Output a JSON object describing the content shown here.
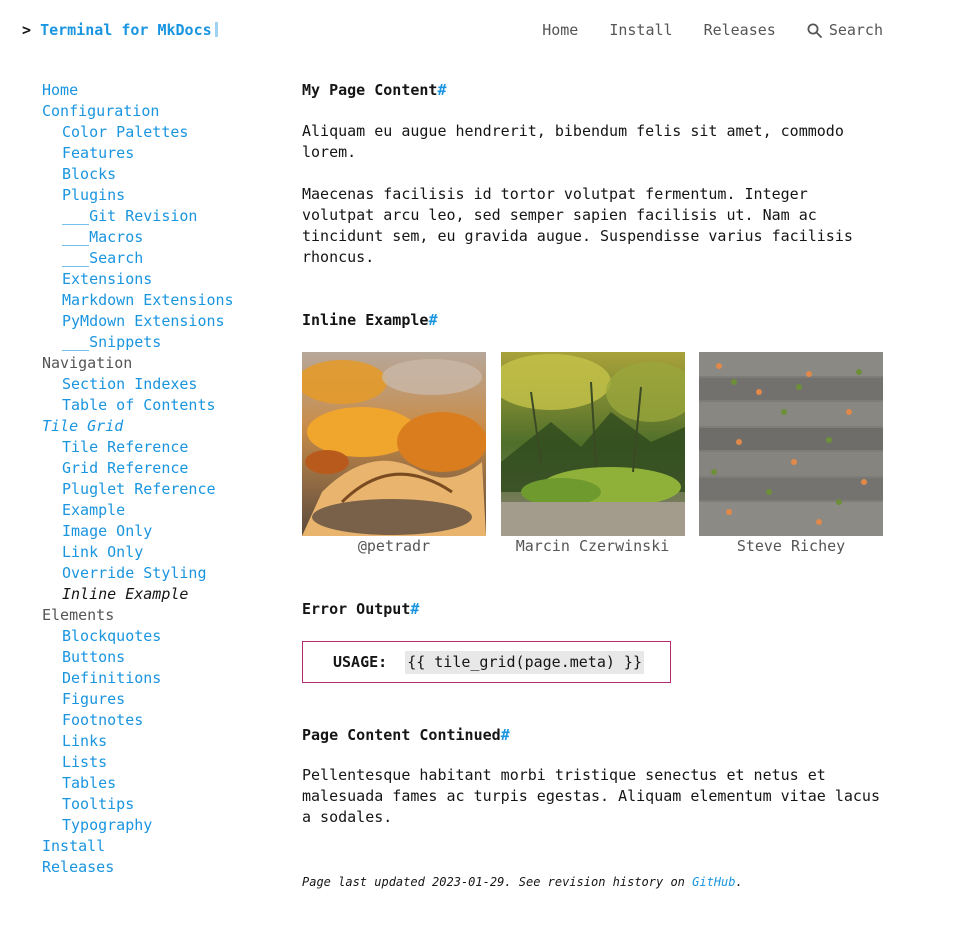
{
  "header": {
    "prompt": ">",
    "site_name": "Terminal for MkDocs",
    "nav": [
      "Home",
      "Install",
      "Releases"
    ],
    "search_label": "Search"
  },
  "sidebar": {
    "items": [
      {
        "label": "Home",
        "level": 1,
        "kind": "link"
      },
      {
        "label": "Configuration",
        "level": 1,
        "kind": "link"
      },
      {
        "label": "Color Palettes",
        "level": 2,
        "kind": "link"
      },
      {
        "label": "Features",
        "level": 2,
        "kind": "link"
      },
      {
        "label": "Blocks",
        "level": 2,
        "kind": "link"
      },
      {
        "label": "Plugins",
        "level": 2,
        "kind": "link"
      },
      {
        "label": "___Git Revision",
        "level": 2,
        "kind": "link"
      },
      {
        "label": "___Macros",
        "level": 2,
        "kind": "link"
      },
      {
        "label": "___Search",
        "level": 2,
        "kind": "link"
      },
      {
        "label": "Extensions",
        "level": 2,
        "kind": "link"
      },
      {
        "label": "Markdown Extensions",
        "level": 2,
        "kind": "link"
      },
      {
        "label": "PyMdown Extensions",
        "level": 2,
        "kind": "link"
      },
      {
        "label": "___Snippets",
        "level": 2,
        "kind": "link"
      },
      {
        "label": "Navigation",
        "level": 1,
        "kind": "section"
      },
      {
        "label": "Section Indexes",
        "level": 2,
        "kind": "link"
      },
      {
        "label": "Table of Contents",
        "level": 2,
        "kind": "link"
      },
      {
        "label": "Tile Grid",
        "level": 1,
        "kind": "active-section"
      },
      {
        "label": "Tile Reference",
        "level": 2,
        "kind": "link"
      },
      {
        "label": "Grid Reference",
        "level": 2,
        "kind": "link"
      },
      {
        "label": "Pluglet Reference",
        "level": 2,
        "kind": "link"
      },
      {
        "label": "Example",
        "level": 2,
        "kind": "link"
      },
      {
        "label": "Image Only",
        "level": 2,
        "kind": "link"
      },
      {
        "label": "Link Only",
        "level": 2,
        "kind": "link"
      },
      {
        "label": "Override Styling",
        "level": 2,
        "kind": "link"
      },
      {
        "label": "Inline Example",
        "level": 2,
        "kind": "current"
      },
      {
        "label": "Elements",
        "level": 1,
        "kind": "section"
      },
      {
        "label": "Blockquotes",
        "level": 2,
        "kind": "link"
      },
      {
        "label": "Buttons",
        "level": 2,
        "kind": "link"
      },
      {
        "label": "Definitions",
        "level": 2,
        "kind": "link"
      },
      {
        "label": "Figures",
        "level": 2,
        "kind": "link"
      },
      {
        "label": "Footnotes",
        "level": 2,
        "kind": "link"
      },
      {
        "label": "Links",
        "level": 2,
        "kind": "link"
      },
      {
        "label": "Lists",
        "level": 2,
        "kind": "link"
      },
      {
        "label": "Tables",
        "level": 2,
        "kind": "link"
      },
      {
        "label": "Tooltips",
        "level": 2,
        "kind": "link"
      },
      {
        "label": "Typography",
        "level": 2,
        "kind": "link"
      },
      {
        "label": "Install",
        "level": 1,
        "kind": "link"
      },
      {
        "label": "Releases",
        "level": 1,
        "kind": "link"
      }
    ]
  },
  "main": {
    "anchor": "#",
    "section1": {
      "title": "My Page Content",
      "para1_line1": "Aliquam eu augue hendrerit, bibendum felis sit amet, commodo",
      "para1_line2": "lorem.",
      "para2_line1": "Maecenas facilisis id tortor volutpat fermentum. Integer",
      "para2_line2": "volutpat arcu leo, sed semper sapien facilisis ut. Nam ac",
      "para2_line3": "tincidunt sem, eu gravida augue. Suspendisse varius facilisis",
      "para2_line4": "rhoncus."
    },
    "section2": {
      "title": "Inline Example",
      "tiles": [
        {
          "caption": "@petradr"
        },
        {
          "caption": "Marcin Czerwinski"
        },
        {
          "caption": "Steve Richey"
        }
      ]
    },
    "section3": {
      "title": "Error Output",
      "usage_label": "USAGE:",
      "usage_code": "{{ tile_grid(page.meta) }}"
    },
    "section4": {
      "title": "Page Content Continued",
      "line1": "Pellentesque habitant morbi tristique senectus et netus et",
      "line2": "malesuada fames ac turpis egestas. Aliquam elementum vitae lacus",
      "line3": "a sodales."
    },
    "footer": {
      "prefix": "Page last updated 2023-01-29. See revision history on ",
      "link": "GitHub",
      "suffix": "."
    }
  },
  "colors": {
    "accent": "#1a95e0",
    "error_border": "#b72a75",
    "code_bg": "#e8e8e8"
  }
}
